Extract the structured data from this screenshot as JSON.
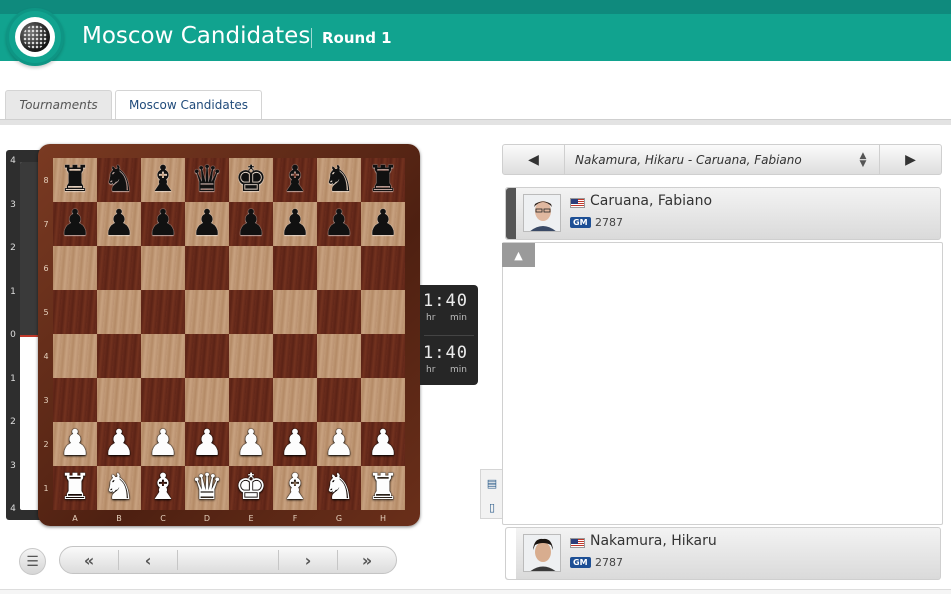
{
  "header": {
    "event_title": "Moscow Candidates",
    "round": "Round 1",
    "logo_icon": "chessbomb-ball-logo-icon"
  },
  "tabs": [
    {
      "label": "Tournaments",
      "active": false
    },
    {
      "label": "Moscow Candidates",
      "active": true
    }
  ],
  "eval_bar": {
    "labels": [
      "4",
      "3",
      "2",
      "1",
      "0",
      "1",
      "2",
      "3",
      "4"
    ],
    "evaluation": 0.0
  },
  "board": {
    "ranks": [
      "8",
      "7",
      "6",
      "5",
      "4",
      "3",
      "2",
      "1"
    ],
    "files": [
      "A",
      "B",
      "C",
      "D",
      "E",
      "F",
      "G",
      "H"
    ],
    "position": [
      [
        "r",
        "n",
        "b",
        "q",
        "k",
        "b",
        "n",
        "r"
      ],
      [
        "p",
        "p",
        "p",
        "p",
        "p",
        "p",
        "p",
        "p"
      ],
      [
        "",
        "",
        "",
        "",
        "",
        "",
        "",
        ""
      ],
      [
        "",
        "",
        "",
        "",
        "",
        "",
        "",
        ""
      ],
      [
        "",
        "",
        "",
        "",
        "",
        "",
        "",
        ""
      ],
      [
        "",
        "",
        "",
        "",
        "",
        "",
        "",
        ""
      ],
      [
        "P",
        "P",
        "P",
        "P",
        "P",
        "P",
        "P",
        "P"
      ],
      [
        "R",
        "N",
        "B",
        "Q",
        "K",
        "B",
        "N",
        "R"
      ]
    ]
  },
  "clocks": {
    "top": {
      "time": "1:40",
      "hr_label": "hr",
      "min_label": "min"
    },
    "bottom": {
      "time": "1:40",
      "hr_label": "hr",
      "min_label": "min"
    }
  },
  "navigation": {
    "menu_icon": "hamburger-icon",
    "first": "«",
    "prev": "‹",
    "next": "›",
    "last": "»"
  },
  "game_selector": {
    "prev_icon": "triangle-left-icon",
    "label": "Nakamura, Hikaru - Caruana, Fabiano",
    "updown_icon": "sort-updown-icon",
    "next_icon": "triangle-right-icon"
  },
  "players": {
    "black": {
      "name": "Caruana, Fabiano",
      "title": "GM",
      "rating": "2787",
      "flag": "us-flag-icon",
      "color": "#555555"
    },
    "white": {
      "name": "Nakamura, Hikaru",
      "title": "GM",
      "rating": "2787",
      "flag": "us-flag-icon",
      "color": "#ffffff"
    }
  },
  "moves_panel": {
    "collapse_icon": "triangle-up-icon"
  },
  "side_icons": [
    "notation-list-icon",
    "chat-bubbles-icon"
  ]
}
